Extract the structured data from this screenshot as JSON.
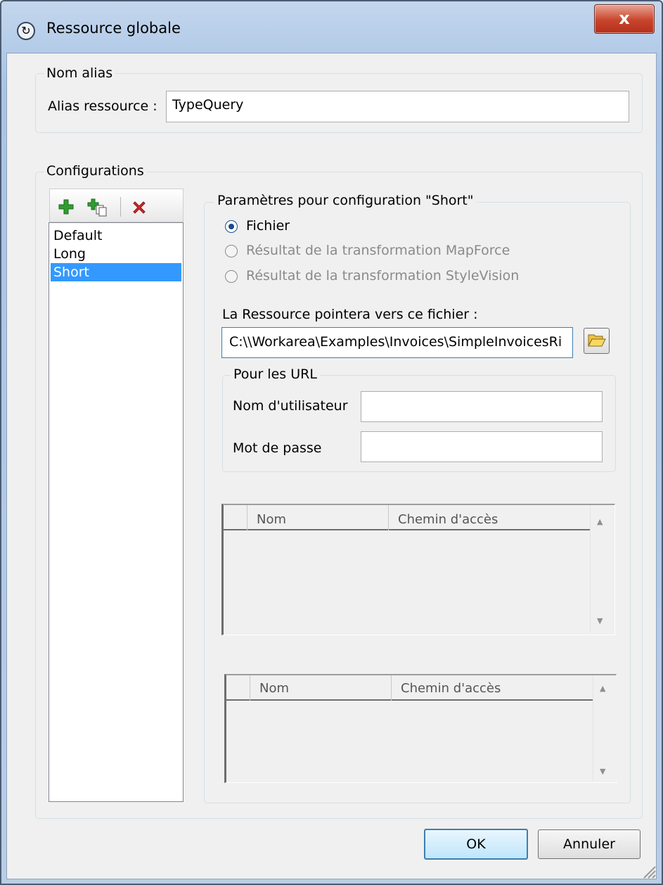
{
  "window": {
    "title": "Ressource globale",
    "close_glyph": "x"
  },
  "alias_group": {
    "legend": "Nom alias",
    "label": "Alias ressource :",
    "value": "TypeQuery"
  },
  "configurations": {
    "legend": "Configurations",
    "toolbar_icons": [
      "add-configuration-icon",
      "copy-configuration-icon",
      "delete-configuration-icon"
    ],
    "items": [
      "Default",
      "Long",
      "Short"
    ],
    "selected": "Short"
  },
  "params": {
    "legend": "Paramètres pour configuration \"Short\"",
    "radio_file": "Fichier",
    "radio_mapforce": "Résultat de la transformation MapForce",
    "radio_stylevision": "Résultat de la transformation StyleVision",
    "file_label": "La Ressource pointera vers ce fichier :",
    "file_path": "C:\\\\Workarea\\Examples\\Invoices\\SimpleInvoicesRi",
    "url_group": {
      "legend": "Pour les URL",
      "user_label": "Nom d'utilisateur",
      "user_value": "",
      "pass_label": "Mot de passe",
      "pass_value": ""
    },
    "grid1": {
      "col_name": "Nom",
      "col_path": "Chemin d'accès"
    },
    "grid2": {
      "col_name": "Nom",
      "col_path": "Chemin d'accès"
    }
  },
  "buttons": {
    "ok": "OK",
    "cancel": "Annuler"
  },
  "colors": {
    "selection": "#3399ff",
    "default_button_border": "#3c7fb1",
    "close_button": "#c8442c"
  }
}
